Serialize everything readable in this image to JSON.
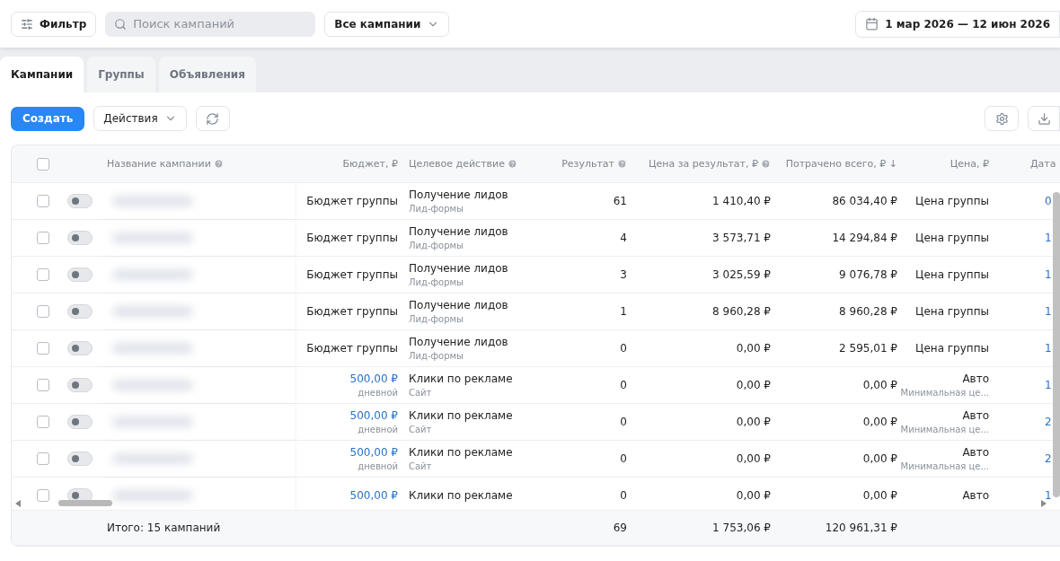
{
  "toolbar": {
    "filter": "Фильтр",
    "search": {
      "placeholder": "Поиск кампаний"
    },
    "scope": "Все кампании",
    "dates": "1 мар 2026 — 12 июн 2026"
  },
  "tabs": [
    {
      "label": "Кампании",
      "selected": true
    },
    {
      "label": "Группы",
      "selected": false
    },
    {
      "label": "Объявления",
      "selected": false
    }
  ],
  "actions": {
    "create": "Создать",
    "menu": "Действия"
  },
  "table": {
    "header_checked": false,
    "columns": [
      {
        "label": "Название кампании",
        "help": true
      },
      {
        "label": "Бюджет, ₽",
        "help": false
      },
      {
        "label": "Целевое действие",
        "help": true
      },
      {
        "label": "Результат",
        "help": true
      },
      {
        "label": "Цена за результат, ₽",
        "help": true
      },
      {
        "label": "Потрачено всего, ₽ ↓",
        "help": false
      },
      {
        "label": "Цена, ₽",
        "help": false
      },
      {
        "label": "Дата",
        "help": false
      }
    ],
    "rows": [
      {
        "checked": false,
        "on": false,
        "kind": "group",
        "budget": "Бюджет группы",
        "goal": "Получение лидов",
        "goal_note": "Лид-формы",
        "result": "61",
        "cost_per_result": "1 410,40 ₽",
        "spent": "86 034,40 ₽",
        "price": "Цена группы",
        "date": "0"
      },
      {
        "checked": false,
        "on": false,
        "kind": "group",
        "budget": "Бюджет группы",
        "goal": "Получение лидов",
        "goal_note": "Лид-формы",
        "result": "4",
        "cost_per_result": "3 573,71 ₽",
        "spent": "14 294,84 ₽",
        "price": "Цена группы",
        "date": "1"
      },
      {
        "checked": false,
        "on": false,
        "kind": "group",
        "budget": "Бюджет группы",
        "goal": "Получение лидов",
        "goal_note": "Лид-формы",
        "result": "3",
        "cost_per_result": "3 025,59 ₽",
        "spent": "9 076,78 ₽",
        "price": "Цена группы",
        "date": "1"
      },
      {
        "checked": false,
        "on": false,
        "kind": "group",
        "budget": "Бюджет группы",
        "goal": "Получение лидов",
        "goal_note": "Лид-формы",
        "result": "1",
        "cost_per_result": "8 960,28 ₽",
        "spent": "8 960,28 ₽",
        "price": "Цена группы",
        "date": "1"
      },
      {
        "checked": false,
        "on": false,
        "kind": "group",
        "budget": "Бюджет группы",
        "goal": "Получение лидов",
        "goal_note": "Лид-формы",
        "result": "0",
        "cost_per_result": "0,00 ₽",
        "spent": "2 595,01 ₽",
        "price": "Цена группы",
        "date": "1"
      },
      {
        "checked": false,
        "on": false,
        "kind": "amount",
        "budget": "500,00 ₽",
        "budget_note": "дневной",
        "goal": "Клики по рекламе",
        "goal_note": "Сайт",
        "result": "0",
        "cost_per_result": "0,00 ₽",
        "spent": "0,00 ₽",
        "price": "Авто",
        "price_note": "Минимальная це...",
        "date": "1"
      },
      {
        "checked": false,
        "on": false,
        "kind": "amount",
        "budget": "500,00 ₽",
        "budget_note": "дневной",
        "goal": "Клики по рекламе",
        "goal_note": "Сайт",
        "result": "0",
        "cost_per_result": "0,00 ₽",
        "spent": "0,00 ₽",
        "price": "Авто",
        "price_note": "Минимальная це...",
        "date": "2"
      },
      {
        "checked": false,
        "on": false,
        "kind": "amount",
        "budget": "500,00 ₽",
        "budget_note": "дневной",
        "goal": "Клики по рекламе",
        "goal_note": "Сайт",
        "result": "0",
        "cost_per_result": "0,00 ₽",
        "spent": "0,00 ₽",
        "price": "Авто",
        "price_note": "Минимальная це...",
        "date": "2"
      },
      {
        "checked": false,
        "on": false,
        "kind": "amount",
        "budget": "500,00 ₽",
        "goal": "Клики по рекламе",
        "result": "0",
        "cost_per_result": "0,00 ₽",
        "spent": "0,00 ₽",
        "price": "Авто",
        "date": "1"
      }
    ],
    "footer": {
      "total": "Итого: 15 кампаний",
      "result": "69",
      "cost_per_result": "1 753,06 ₽",
      "spent": "120 961,31 ₽"
    }
  }
}
